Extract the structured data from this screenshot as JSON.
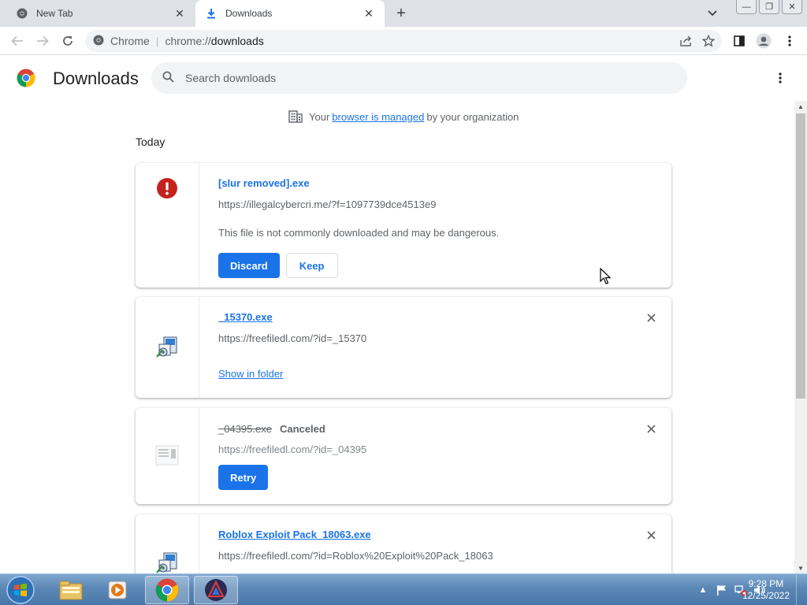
{
  "tabs": [
    {
      "title": "New Tab",
      "close": "✕"
    },
    {
      "title": "Downloads",
      "close": "✕"
    }
  ],
  "new_tab_symbol": "+",
  "window_controls": {
    "minimize": "—",
    "restore": "❐",
    "close": "✕"
  },
  "omnibox": {
    "site_label": "Chrome",
    "separator": "|",
    "url_scheme": "chrome://",
    "url_host": "downloads"
  },
  "page": {
    "title": "Downloads",
    "search_placeholder": "Search downloads"
  },
  "managed_notice": {
    "prefix": "Your",
    "link": "browser is managed",
    "suffix": "by your organization"
  },
  "section_date": "Today",
  "downloads": [
    {
      "filename": "[slur removed].exe",
      "url": "https://illegalcybercri.me/?f=1097739dce4513e9",
      "warning": "This file is not commonly downloaded and may be dangerous.",
      "primary_action": "Discard",
      "secondary_action": "Keep",
      "icon": "danger-icon"
    },
    {
      "filename": "_15370.exe",
      "url": "https://freefiledl.com/?id=_15370",
      "action_link": "Show in folder",
      "icon": "installer-icon"
    },
    {
      "filename": "_04395.exe",
      "status": "Canceled",
      "url": "https://freefiledl.com/?id=_04395",
      "primary_action": "Retry",
      "icon": "generic-file-icon"
    },
    {
      "filename": "Roblox Exploit Pack_18063.exe",
      "url": "https://freefiledl.com/?id=Roblox%20Exploit%20Pack_18063",
      "icon": "installer-icon"
    }
  ],
  "taskbar": {
    "clock_time": "9:28 PM",
    "clock_date": "12/25/2022",
    "tray_expand": "▲",
    "items": [
      "start-orb",
      "file-explorer",
      "media-player",
      "chrome",
      "app"
    ]
  },
  "colors": {
    "accent": "#1a73e8",
    "danger": "#c5221f",
    "tab_strip": "#dee1e6",
    "taskbar": "#5b87b6"
  }
}
